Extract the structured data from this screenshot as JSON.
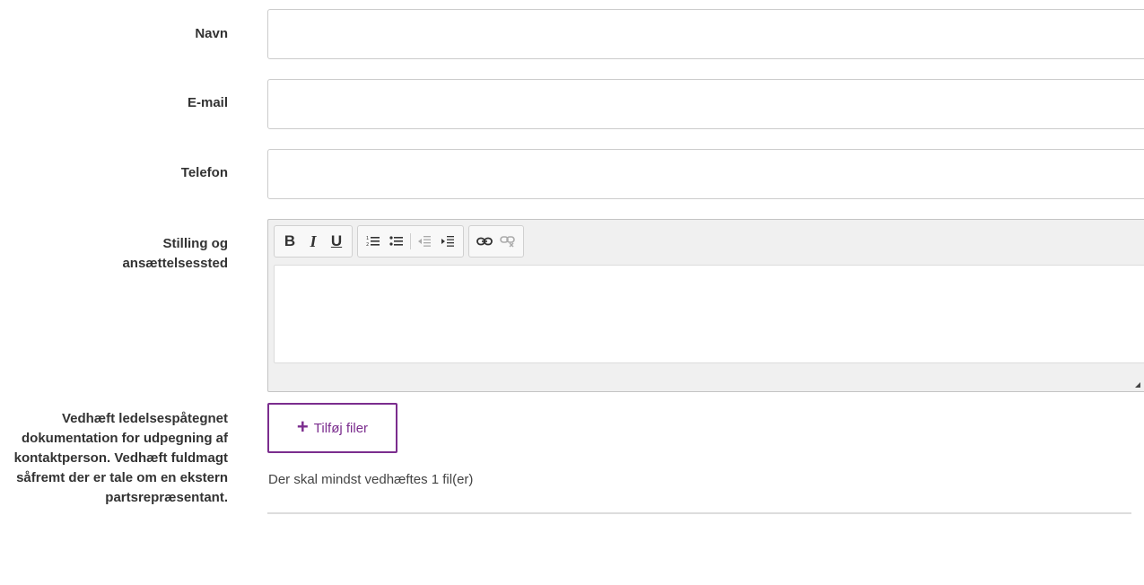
{
  "fields": {
    "name": {
      "label": "Navn",
      "value": ""
    },
    "email": {
      "label": "E-mail",
      "value": ""
    },
    "phone": {
      "label": "Telefon",
      "value": ""
    },
    "position": {
      "label": "Stilling og ansættelsessted"
    }
  },
  "editor": {
    "toolbar": {
      "bold": "B",
      "italic": "I",
      "underline": "U"
    },
    "icons": [
      "numbered-list-icon",
      "bulleted-list-icon",
      "outdent-icon",
      "indent-icon",
      "link-icon",
      "unlink-icon"
    ]
  },
  "attachment": {
    "label": "Vedhæft ledelsespåtegnet dokumentation for udpegning af kontaktperson. Vedhæft fuldmagt såfremt der er tale om en ekstern partsrepræsentant.",
    "button_label": "Tilføj filer",
    "plus_symbol": "+",
    "hint": "Der skal mindst vedhæftes 1 fil(er)"
  },
  "colors": {
    "accent": "#7b2d8e",
    "border": "#cccccc",
    "label_text": "#333333"
  }
}
